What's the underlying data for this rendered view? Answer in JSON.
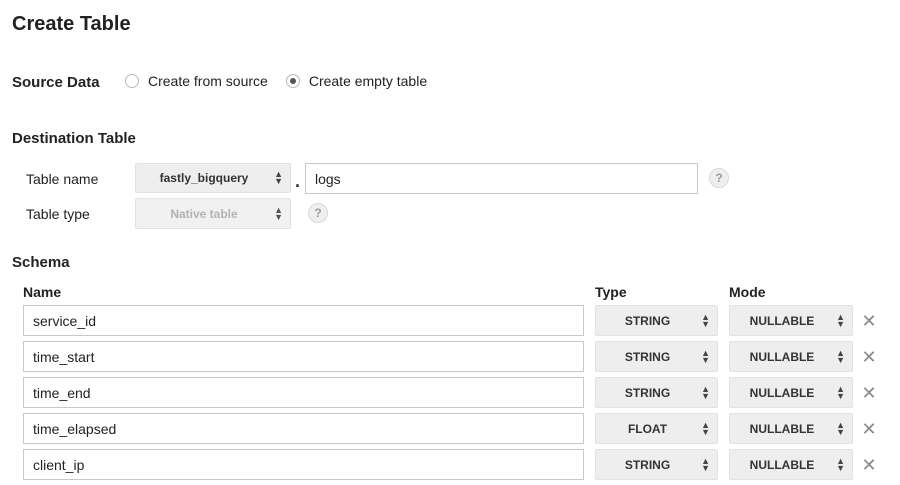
{
  "page": {
    "title": "Create Table"
  },
  "source_data": {
    "label": "Source Data",
    "options": [
      {
        "label": "Create from source",
        "checked": false
      },
      {
        "label": "Create empty table",
        "checked": true
      }
    ]
  },
  "destination": {
    "label": "Destination Table",
    "table_name_label": "Table name",
    "dataset_value": "fastly_bigquery",
    "separator": ".",
    "table_name_value": "logs",
    "table_type_label": "Table type",
    "table_type_value": "Native table",
    "help_glyph": "?"
  },
  "schema": {
    "label": "Schema",
    "headers": {
      "name": "Name",
      "type": "Type",
      "mode": "Mode"
    },
    "rows": [
      {
        "name": "service_id",
        "type": "STRING",
        "mode": "NULLABLE"
      },
      {
        "name": "time_start",
        "type": "STRING",
        "mode": "NULLABLE"
      },
      {
        "name": "time_end",
        "type": "STRING",
        "mode": "NULLABLE"
      },
      {
        "name": "time_elapsed",
        "type": "FLOAT",
        "mode": "NULLABLE"
      },
      {
        "name": "client_ip",
        "type": "STRING",
        "mode": "NULLABLE"
      }
    ]
  },
  "icons": {
    "select_arrows": "up-down-arrows-icon",
    "remove": "close-icon",
    "help": "help-icon"
  }
}
